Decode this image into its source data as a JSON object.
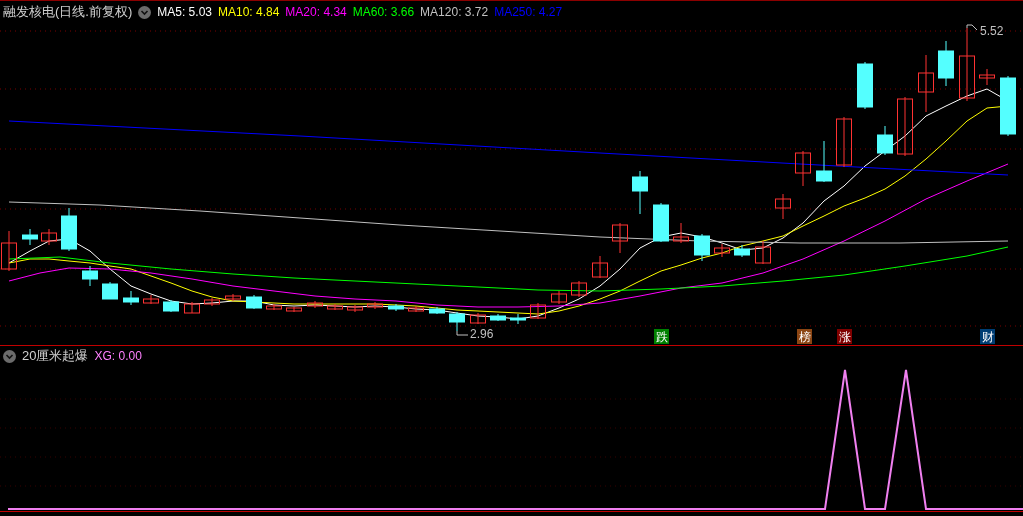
{
  "main_chart": {
    "title": "融发核电(日线.前复权)",
    "moving_averages": [
      {
        "label": "MA5: 5.03",
        "color": "#ffffff"
      },
      {
        "label": "MA10: 4.84",
        "color": "#ffff00"
      },
      {
        "label": "MA20: 4.34",
        "color": "#ff00ff"
      },
      {
        "label": "MA60: 3.66",
        "color": "#00ff00"
      },
      {
        "label": "MA120: 3.72",
        "color": "#c0c0c0"
      },
      {
        "label": "MA250: 4.27",
        "color": "#0000ff"
      }
    ],
    "high_label": "5.52",
    "low_label": "2.96",
    "event_markers": [
      {
        "label": "跌",
        "color": "#008000"
      },
      {
        "label": "榜",
        "color": "#8b4513"
      },
      {
        "label": "涨",
        "color": "#800000"
      },
      {
        "label": "财",
        "color": "#003d73"
      }
    ]
  },
  "indicator_panel": {
    "title": "20厘米起爆",
    "value": "XG: 0.00"
  }
}
